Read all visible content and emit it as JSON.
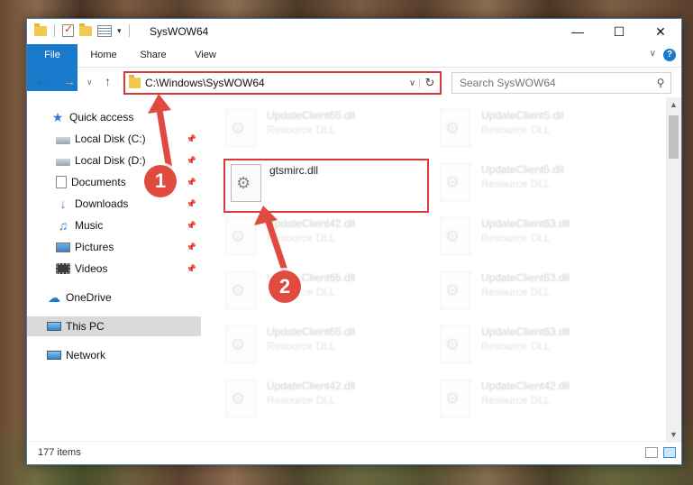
{
  "window": {
    "title": "SysWOW64"
  },
  "ribbon": {
    "tabs": [
      "File",
      "Home",
      "Share",
      "View"
    ],
    "help": "?"
  },
  "nav": {
    "address": "C:\\Windows\\SysWOW64",
    "search_placeholder": "Search SysWOW64"
  },
  "sidebar": {
    "items": [
      {
        "label": "Quick access",
        "icon": "star-icon"
      },
      {
        "label": "Local Disk (C:)",
        "icon": "drive-icon"
      },
      {
        "label": "Local Disk (D:)",
        "icon": "drive-icon"
      },
      {
        "label": "Documents",
        "icon": "documents-icon"
      },
      {
        "label": "Downloads",
        "icon": "downloads-icon"
      },
      {
        "label": "Music",
        "icon": "music-icon"
      },
      {
        "label": "Pictures",
        "icon": "pictures-icon"
      },
      {
        "label": "Videos",
        "icon": "videos-icon"
      },
      {
        "label": "OneDrive",
        "icon": "onedrive-icon"
      },
      {
        "label": "This PC",
        "icon": "pc-icon"
      },
      {
        "label": "Network",
        "icon": "network-icon"
      }
    ]
  },
  "files": {
    "col1": [
      {
        "name": "UpdateClient65.dll",
        "type": "Resource DLL"
      },
      {
        "name": "gtsmirc.dll",
        "type": ""
      },
      {
        "name": "UpdateClient42.dll",
        "type": "Resource DLL"
      },
      {
        "name": "UpdateClient65.dll",
        "type": "Resource DLL"
      },
      {
        "name": "UpdateClient65.dll",
        "type": "Resource DLL"
      },
      {
        "name": "UpdateClient42.dll",
        "type": "Resource DLL"
      }
    ],
    "col2": [
      {
        "name": "UpdateClient5.dll",
        "type": "Resource DLL"
      },
      {
        "name": "UpdateClient5.dll",
        "type": "Resource DLL"
      },
      {
        "name": "UpdateClient63.dll",
        "type": "Resource DLL"
      },
      {
        "name": "UpdateClient63.dll",
        "type": "Resource DLL"
      },
      {
        "name": "UpdateClient63.dll",
        "type": "Resource DLL"
      },
      {
        "name": "UpdateClient42.dll",
        "type": "Resource DLL"
      }
    ]
  },
  "status": {
    "count": "177 items"
  },
  "callouts": {
    "one": "1",
    "two": "2"
  },
  "colors": {
    "accent": "#1979ca",
    "highlight_red": "#d9383a",
    "callout_red": "#e04a3f"
  }
}
